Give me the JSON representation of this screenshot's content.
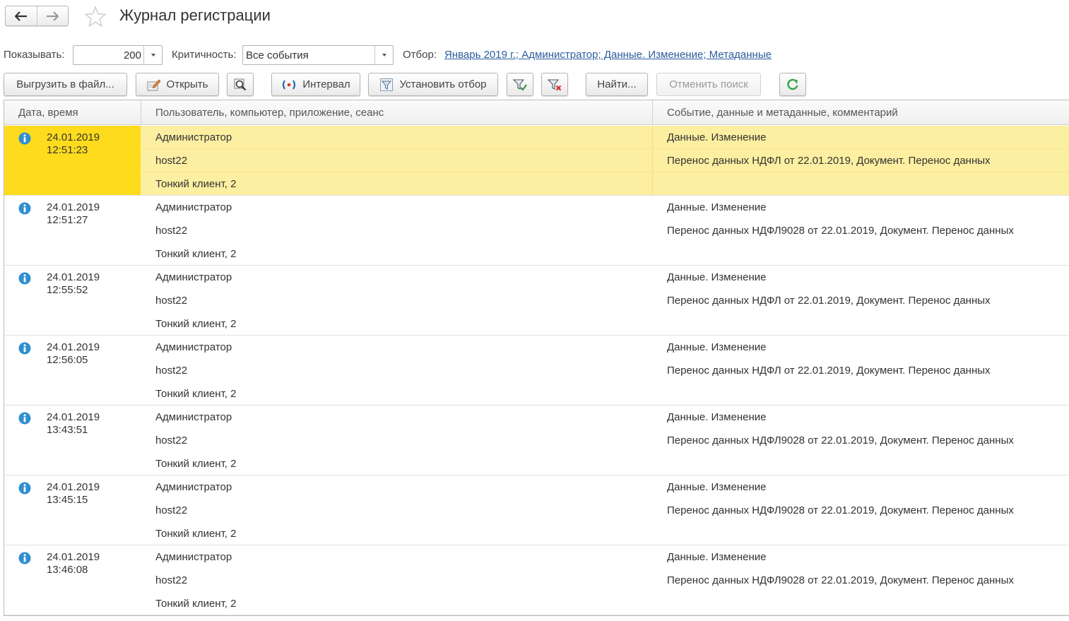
{
  "header": {
    "title": "Журнал регистрации",
    "back_icon": "arrow-left-icon",
    "forward_icon": "arrow-right-icon",
    "favorite_icon": "star-icon"
  },
  "filters": {
    "show_label": "Показывать:",
    "show_value": "200",
    "severity_label": "Критичность:",
    "severity_value": "Все события",
    "filter_label": "Отбор:",
    "filter_value": "Январь 2019 г.; Администратор; Данные. Изменение; Метаданные"
  },
  "toolbar": {
    "export_label": "Выгрузить в файл...",
    "open_label": "Открыть",
    "interval_label": "Интервал",
    "set_filter_label": "Установить отбор",
    "find_label": "Найти...",
    "cancel_search_label": "Отменить поиск"
  },
  "table": {
    "columns": [
      "Дата, время",
      "Пользователь, компьютер, приложение, сеанс",
      "Событие, данные и метаданные, комментарий"
    ],
    "rows": [
      {
        "date": "24.01.2019",
        "time": "12:51:23",
        "user": "Администратор",
        "computer": "host22",
        "app": "Тонкий клиент, 2",
        "event": "Данные. Изменение",
        "data": "Перенос данных НДФЛ от 22.01.2019, Документ. Перенос данных",
        "comment": ""
      },
      {
        "date": "24.01.2019",
        "time": "12:51:27",
        "user": "Администратор",
        "computer": "host22",
        "app": "Тонкий клиент, 2",
        "event": "Данные. Изменение",
        "data": "Перенос данных НДФЛ9028 от 22.01.2019, Документ. Перенос данных",
        "comment": ""
      },
      {
        "date": "24.01.2019",
        "time": "12:55:52",
        "user": "Администратор",
        "computer": "host22",
        "app": "Тонкий клиент, 2",
        "event": "Данные. Изменение",
        "data": "Перенос данных НДФЛ от 22.01.2019, Документ. Перенос данных",
        "comment": ""
      },
      {
        "date": "24.01.2019",
        "time": "12:56:05",
        "user": "Администратор",
        "computer": "host22",
        "app": "Тонкий клиент, 2",
        "event": "Данные. Изменение",
        "data": "Перенос данных НДФЛ от 22.01.2019, Документ. Перенос данных",
        "comment": ""
      },
      {
        "date": "24.01.2019",
        "time": "13:43:51",
        "user": "Администратор",
        "computer": "host22",
        "app": "Тонкий клиент, 2",
        "event": "Данные. Изменение",
        "data": "Перенос данных НДФЛ9028 от 22.01.2019, Документ. Перенос данных",
        "comment": ""
      },
      {
        "date": "24.01.2019",
        "time": "13:45:15",
        "user": "Администратор",
        "computer": "host22",
        "app": "Тонкий клиент, 2",
        "event": "Данные. Изменение",
        "data": "Перенос данных НДФЛ9028 от 22.01.2019, Документ. Перенос данных",
        "comment": ""
      },
      {
        "date": "24.01.2019",
        "time": "13:46:08",
        "user": "Администратор",
        "computer": "host22",
        "app": "Тонкий клиент, 2",
        "event": "Данные. Изменение",
        "data": "Перенос данных НДФЛ9028 от 22.01.2019, Документ. Перенос данных",
        "comment": ""
      }
    ]
  },
  "colors": {
    "selected_row": "#fcefa1",
    "selected_cell": "#fedc1d",
    "link": "#2b5c9c",
    "info_icon": "#2f8fd0",
    "refresh_icon": "#2ea84a"
  }
}
